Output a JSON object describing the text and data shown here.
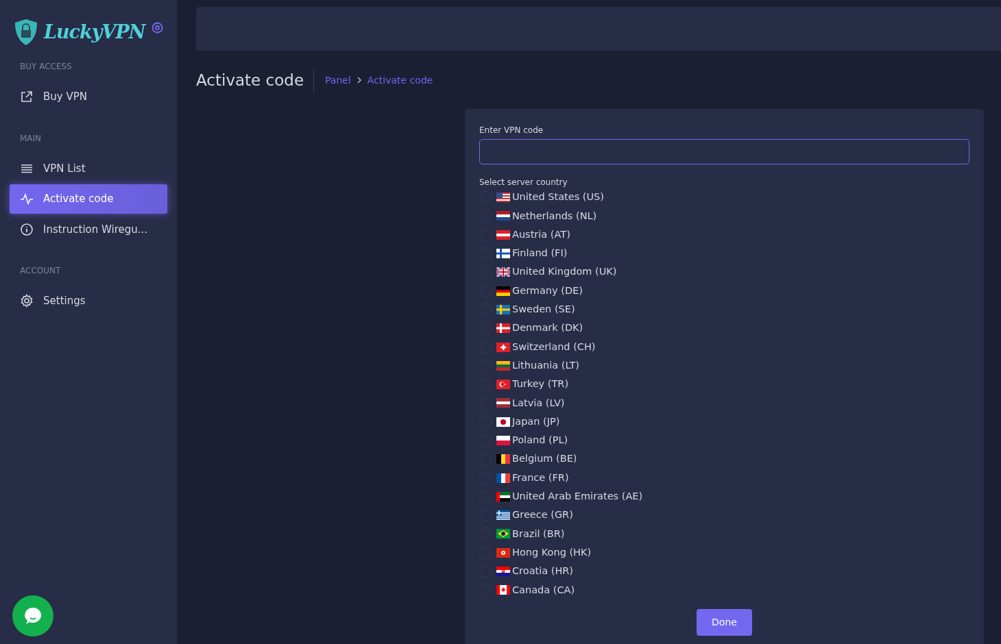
{
  "sidebar": {
    "logo": "LuckyVPN",
    "sections": [
      {
        "heading": "BUY ACCESS",
        "items": [
          {
            "label": "Buy VPN",
            "kind": "external",
            "selected": false
          }
        ]
      },
      {
        "heading": "MAIN",
        "items": [
          {
            "label": "VPN List",
            "kind": "list",
            "selected": false
          },
          {
            "label": "Activate code",
            "kind": "pulse",
            "selected": true
          },
          {
            "label": "Instruction Wiregu...",
            "kind": "info",
            "selected": false
          }
        ]
      },
      {
        "heading": "ACCOUNT",
        "items": [
          {
            "label": "Settings",
            "kind": "gear",
            "selected": false
          }
        ]
      }
    ]
  },
  "page": {
    "title": "Activate code",
    "breadcrumbs": [
      "Panel",
      "Activate code"
    ]
  },
  "form": {
    "code_label": "Enter VPN code",
    "country_label": "Select server country",
    "countries": [
      {
        "label": "United States (US)",
        "kind": "us",
        "selected": false
      },
      {
        "label": "Netherlands (NL)",
        "kind": "nl",
        "selected": false
      },
      {
        "label": "Austria (AT)",
        "kind": "at",
        "selected": false
      },
      {
        "label": "Finland (FI)",
        "kind": "fi",
        "selected": false
      },
      {
        "label": "United Kingdom (UK)",
        "kind": "uk",
        "selected": false
      },
      {
        "label": "Germany (DE)",
        "kind": "de",
        "selected": false
      },
      {
        "label": "Sweden (SE)",
        "kind": "se",
        "selected": false
      },
      {
        "label": "Denmark (DK)",
        "kind": "dk",
        "selected": false
      },
      {
        "label": "Switzerland (CH)",
        "kind": "ch",
        "selected": false
      },
      {
        "label": "Lithuania (LT)",
        "kind": "lt",
        "selected": false
      },
      {
        "label": "Turkey (TR)",
        "kind": "tr",
        "selected": false
      },
      {
        "label": "Latvia (LV)",
        "kind": "lv",
        "selected": false
      },
      {
        "label": "Japan (JP)",
        "kind": "jp",
        "selected": false
      },
      {
        "label": "Poland (PL)",
        "kind": "pl",
        "selected": false
      },
      {
        "label": "Belgium (BE)",
        "kind": "be",
        "selected": false
      },
      {
        "label": "France (FR)",
        "kind": "fr",
        "selected": false
      },
      {
        "label": "United Arab Emirates (AE)",
        "kind": "ae",
        "selected": false
      },
      {
        "label": "Greece (GR)",
        "kind": "gr",
        "selected": false
      },
      {
        "label": "Brazil (BR)",
        "kind": "br",
        "selected": false
      },
      {
        "label": "Hong Kong (HK)",
        "kind": "hk",
        "selected": false
      },
      {
        "label": "Croatia (HR)",
        "kind": "hr",
        "selected": false
      },
      {
        "label": "Canada (CA)",
        "kind": "ca",
        "selected": false
      }
    ],
    "submit": "Done"
  }
}
